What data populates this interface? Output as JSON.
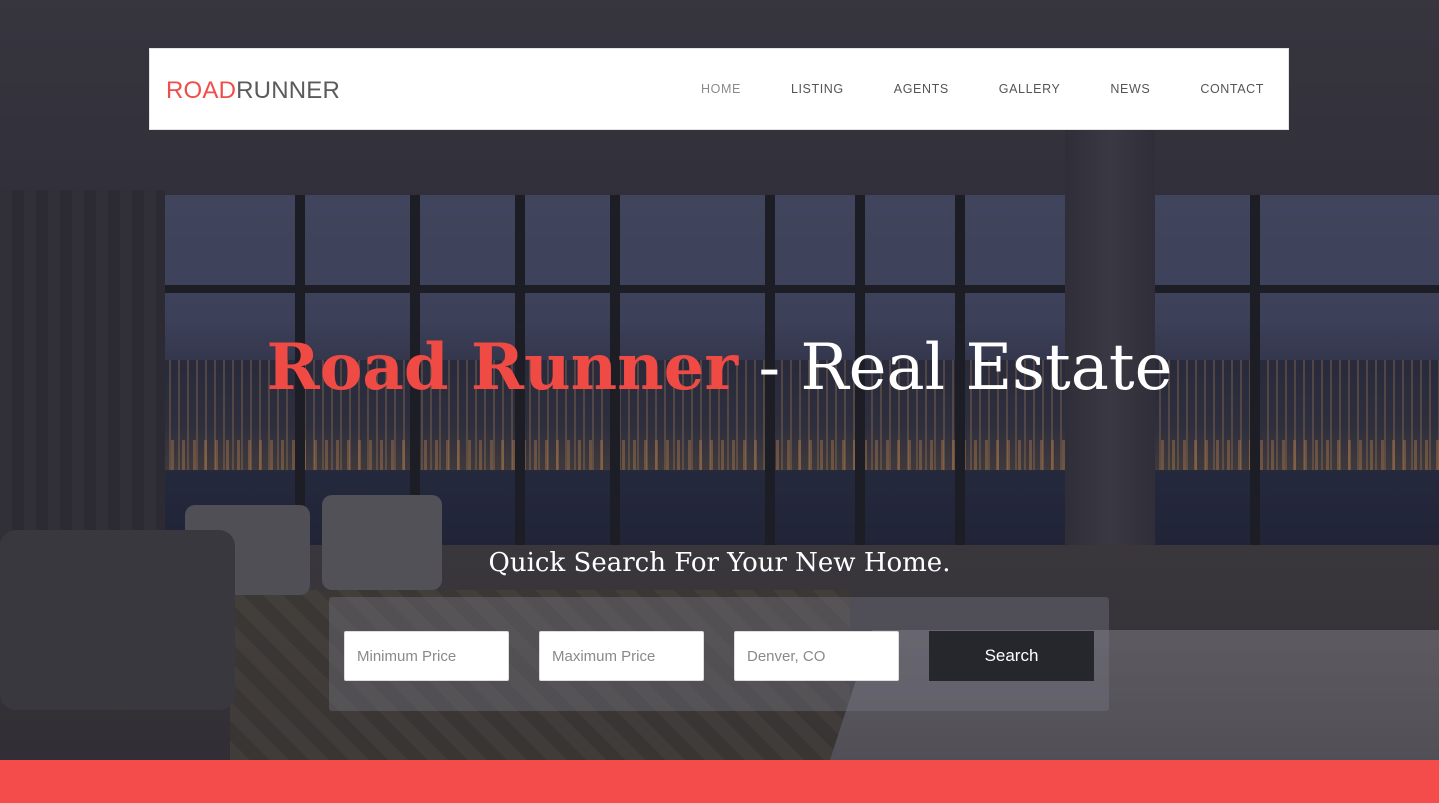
{
  "brand": {
    "part1": "ROAD",
    "part2": "RUNNER"
  },
  "nav": {
    "items": [
      {
        "label": "HOME"
      },
      {
        "label": "LISTING"
      },
      {
        "label": "AGENTS"
      },
      {
        "label": "GALLERY"
      },
      {
        "label": "NEWS"
      },
      {
        "label": "CONTACT"
      }
    ],
    "active": "HOME"
  },
  "hero": {
    "title_highlight": "Road Runner",
    "title_rest": " - Real Estate",
    "subtitle": "Quick Search For Your New Home."
  },
  "search": {
    "min_price_placeholder": "Minimum Price",
    "max_price_placeholder": "Maximum Price",
    "location_placeholder": "Denver, CO",
    "button_label": "Search"
  },
  "colors": {
    "accent": "#f14d4a",
    "button_dark": "#25272d",
    "footer_band": "#f34c4a"
  }
}
